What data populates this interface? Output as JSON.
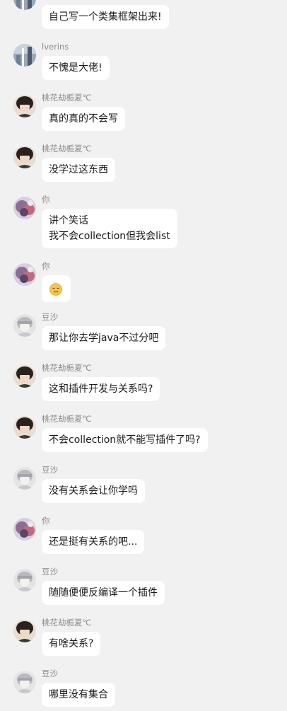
{
  "messages": [
    {
      "sender": "",
      "avatar": "lverins",
      "lines": [
        "自己写一个类集框架出来!"
      ]
    },
    {
      "sender": "lverins",
      "avatar": "lverins",
      "lines": [
        "不愧是大佬!"
      ]
    },
    {
      "sender": "桃花劫栀夏℃",
      "avatar": "taohua",
      "lines": [
        "真的真的不会写"
      ]
    },
    {
      "sender": "桃花劫栀夏℃",
      "avatar": "taohua",
      "lines": [
        "没学过这东西"
      ]
    },
    {
      "sender": "你",
      "avatar": "you",
      "lines": [
        "讲个笑话",
        "我不会collection但我会list"
      ]
    },
    {
      "sender": "你",
      "avatar": "you",
      "lines": [],
      "emoji": "sad-face-emoji"
    },
    {
      "sender": "豆沙",
      "avatar": "dousha",
      "lines": [
        "那让你去学java不过分吧"
      ]
    },
    {
      "sender": "桃花劫栀夏℃",
      "avatar": "taohua",
      "lines": [
        "这和插件开发与关系吗?"
      ]
    },
    {
      "sender": "桃花劫栀夏℃",
      "avatar": "taohua",
      "lines": [
        "不会collection就不能写插件了吗?"
      ]
    },
    {
      "sender": "豆沙",
      "avatar": "dousha",
      "lines": [
        "没有关系会让你学吗"
      ]
    },
    {
      "sender": "你",
      "avatar": "you",
      "lines": [
        "还是挺有关系的吧..."
      ]
    },
    {
      "sender": "豆沙",
      "avatar": "dousha",
      "lines": [
        "随随便便反编译一个插件"
      ]
    },
    {
      "sender": "桃花劫栀夏℃",
      "avatar": "taohua",
      "lines": [
        "有啥关系?"
      ]
    },
    {
      "sender": "豆沙",
      "avatar": "dousha",
      "lines": [
        "哪里没有集合"
      ]
    }
  ],
  "colors": {
    "background": "#f1f1f1",
    "bubble": "#ffffff",
    "nickname": "#8a8a8a",
    "text": "#1a1a1a"
  }
}
